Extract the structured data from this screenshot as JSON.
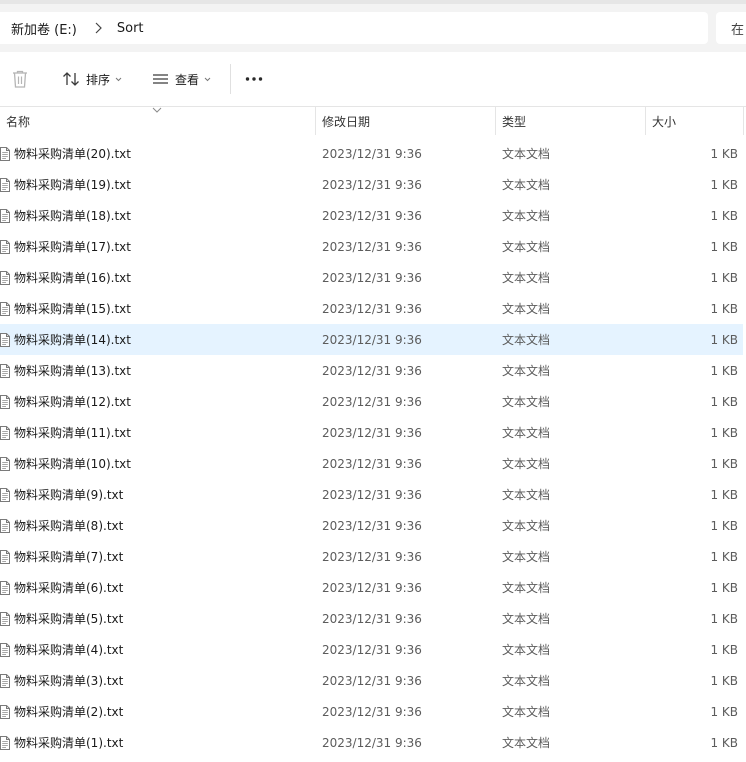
{
  "address_bar": {
    "breadcrumbs": [
      "新加卷 (E:)",
      "Sort"
    ],
    "search_placeholder": "在"
  },
  "toolbar": {
    "sort_label": "排序",
    "view_label": "查看",
    "more_label": "..."
  },
  "columns": {
    "name": "名称",
    "date": "修改日期",
    "type": "类型",
    "size": "大小"
  },
  "files": [
    {
      "name": "物料采购清单(20).txt",
      "date": "2023/12/31 9:36",
      "type": "文本文档",
      "size": "1 KB"
    },
    {
      "name": "物料采购清单(19).txt",
      "date": "2023/12/31 9:36",
      "type": "文本文档",
      "size": "1 KB"
    },
    {
      "name": "物料采购清单(18).txt",
      "date": "2023/12/31 9:36",
      "type": "文本文档",
      "size": "1 KB"
    },
    {
      "name": "物料采购清单(17).txt",
      "date": "2023/12/31 9:36",
      "type": "文本文档",
      "size": "1 KB"
    },
    {
      "name": "物料采购清单(16).txt",
      "date": "2023/12/31 9:36",
      "type": "文本文档",
      "size": "1 KB"
    },
    {
      "name": "物料采购清单(15).txt",
      "date": "2023/12/31 9:36",
      "type": "文本文档",
      "size": "1 KB"
    },
    {
      "name": "物料采购清单(14).txt",
      "date": "2023/12/31 9:36",
      "type": "文本文档",
      "size": "1 KB",
      "selected": true
    },
    {
      "name": "物料采购清单(13).txt",
      "date": "2023/12/31 9:36",
      "type": "文本文档",
      "size": "1 KB"
    },
    {
      "name": "物料采购清单(12).txt",
      "date": "2023/12/31 9:36",
      "type": "文本文档",
      "size": "1 KB"
    },
    {
      "name": "物料采购清单(11).txt",
      "date": "2023/12/31 9:36",
      "type": "文本文档",
      "size": "1 KB"
    },
    {
      "name": "物料采购清单(10).txt",
      "date": "2023/12/31 9:36",
      "type": "文本文档",
      "size": "1 KB"
    },
    {
      "name": "物料采购清单(9).txt",
      "date": "2023/12/31 9:36",
      "type": "文本文档",
      "size": "1 KB"
    },
    {
      "name": "物料采购清单(8).txt",
      "date": "2023/12/31 9:36",
      "type": "文本文档",
      "size": "1 KB"
    },
    {
      "name": "物料采购清单(7).txt",
      "date": "2023/12/31 9:36",
      "type": "文本文档",
      "size": "1 KB"
    },
    {
      "name": "物料采购清单(6).txt",
      "date": "2023/12/31 9:36",
      "type": "文本文档",
      "size": "1 KB"
    },
    {
      "name": "物料采购清单(5).txt",
      "date": "2023/12/31 9:36",
      "type": "文本文档",
      "size": "1 KB"
    },
    {
      "name": "物料采购清单(4).txt",
      "date": "2023/12/31 9:36",
      "type": "文本文档",
      "size": "1 KB"
    },
    {
      "name": "物料采购清单(3).txt",
      "date": "2023/12/31 9:36",
      "type": "文本文档",
      "size": "1 KB"
    },
    {
      "name": "物料采购清单(2).txt",
      "date": "2023/12/31 9:36",
      "type": "文本文档",
      "size": "1 KB"
    },
    {
      "name": "物料采购清单(1).txt",
      "date": "2023/12/31 9:36",
      "type": "文本文档",
      "size": "1 KB"
    }
  ],
  "icons": {
    "delete": "trash-icon",
    "sort": "sort-arrows-icon",
    "view": "view-lines-icon",
    "more": "more-dots-icon",
    "file": "text-file-icon",
    "breadcrumb_sep": "chevron-right-icon"
  },
  "colors": {
    "selected_row": "#e5f3ff",
    "secondary_text": "#5c5c5c"
  }
}
